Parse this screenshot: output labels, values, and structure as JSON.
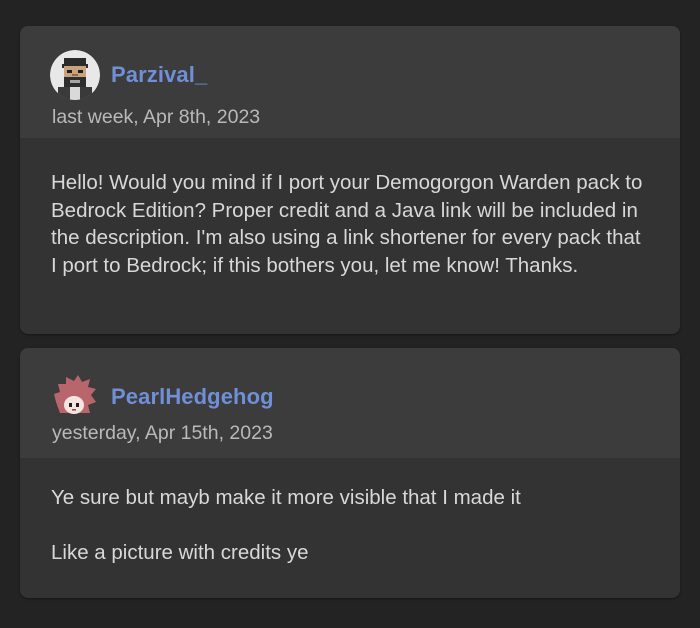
{
  "comments": [
    {
      "author": "Parzival_",
      "avatar": "pixel-bearded-man-avatar",
      "timestamp": "last week, Apr 8th, 2023",
      "body": [
        "Hello! Would you mind if I port your Demogorgon Warden pack to Bedrock Edition? Proper credit and a Java link will be included in the description. I'm also using a link shortener for every pack that I port to Bedrock; if this bothers you, let me know! Thanks."
      ]
    },
    {
      "author": "PearlHedgehog",
      "avatar": "pink-hedgehog-avatar",
      "timestamp": "yesterday, Apr 15th, 2023",
      "body": [
        "Ye sure but mayb make it more visible that I made it",
        "Like a picture with credits ye"
      ]
    }
  ],
  "colors": {
    "background": "#232323",
    "card": "#333333",
    "card_header": "#3c3c3c",
    "author_link": "#6f8fd6",
    "timestamp": "#b9b9b9",
    "body_text": "#d8d8d8"
  }
}
